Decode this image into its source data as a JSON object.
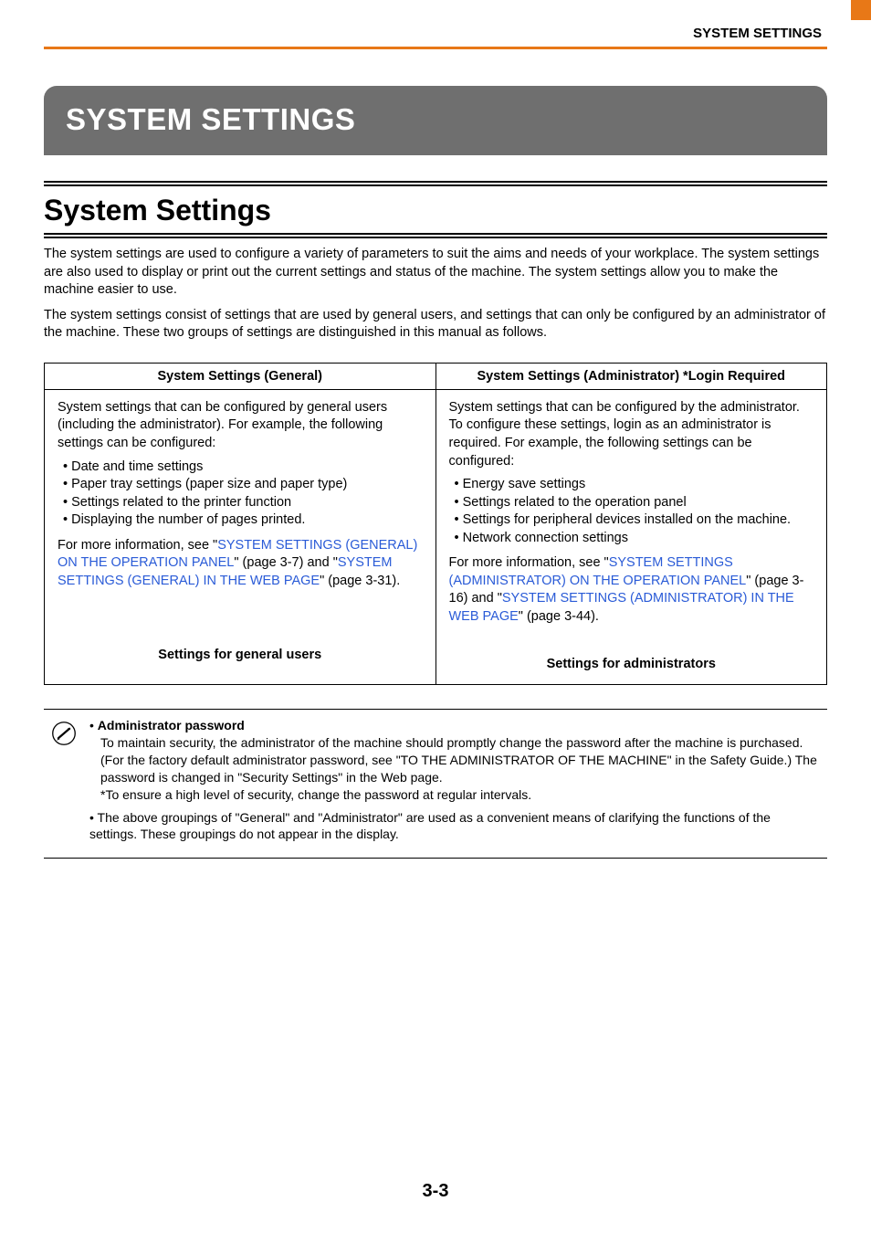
{
  "header": {
    "label": "SYSTEM SETTINGS"
  },
  "title": "SYSTEM SETTINGS",
  "section_heading": "System Settings",
  "intro": {
    "p1": "The system settings are used to configure a variety of parameters to suit the aims and needs of your workplace. The system settings are also used to display or print out the current settings and status of the machine. The system settings allow you to make the machine easier to use.",
    "p2": "The system settings consist of settings that are used by general users, and settings that can only be configured by an administrator of the machine. These two groups of settings are distinguished in this manual as follows."
  },
  "table": {
    "col1_header": "System Settings (General)",
    "col2_header": "System Settings (Administrator) *Login Required",
    "col1": {
      "desc": "System settings that can be configured by general users (including the administrator). For example, the following settings can be configured:",
      "bullets": [
        "• Date and time settings",
        "• Paper tray settings (paper size and paper type)",
        "• Settings related to the printer function",
        "• Displaying the number of pages printed."
      ],
      "more_prefix": "For more information, see \"",
      "link1": "SYSTEM SETTINGS (GENERAL) ON THE OPERATION PANEL",
      "mid1": "\" (page 3-7) and \"",
      "link2": "SYSTEM SETTINGS (GENERAL) IN THE WEB PAGE",
      "suffix": "\" (page 3-31).",
      "footer": "Settings for general users"
    },
    "col2": {
      "desc": "System settings that can be configured by the administrator. To configure these settings, login as an administrator is required. For example, the following settings can be configured:",
      "bullets": [
        "• Energy save settings",
        "• Settings related to the operation panel",
        "• Settings for peripheral devices installed on the machine.",
        "• Network connection settings"
      ],
      "more_prefix": "For more information, see \"",
      "link1": "SYSTEM SETTINGS (ADMINISTRATOR) ON THE OPERATION PANEL",
      "mid1": "\" (page 3-16) and \"",
      "link2": "SYSTEM SETTINGS (ADMINISTRATOR) IN THE WEB PAGE",
      "suffix": "\" (page 3-44).",
      "footer": "Settings for administrators"
    }
  },
  "notes": {
    "item1": {
      "bullet": "• ",
      "title": "Administrator password",
      "body": "To maintain security, the administrator of the machine should promptly change the password after the machine is purchased. (For the factory default administrator password, see \"TO THE ADMINISTRATOR OF THE MACHINE\" in the Safety Guide.) The password is changed in \"Security Settings\" in the Web page.",
      "sub": "*To ensure a high level of security, change the password at regular intervals."
    },
    "item2": {
      "bullet": "• ",
      "body": "The above groupings of \"General\" and \"Administrator\" are used as a convenient means of clarifying the functions of the settings. These groupings do not appear in the display."
    }
  },
  "page_number": "3-3"
}
